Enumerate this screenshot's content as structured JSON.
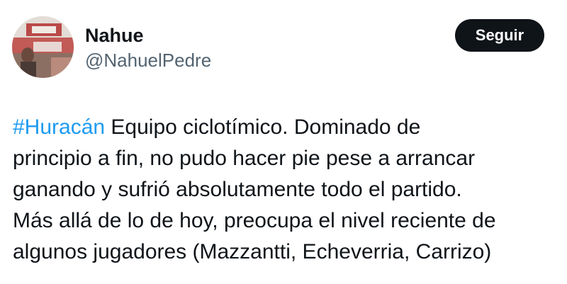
{
  "user": {
    "display_name": "Nahue",
    "handle": "@NahuelPedre"
  },
  "actions": {
    "follow_label": "Seguir"
  },
  "tweet": {
    "hashtag": "#Huracán",
    "line1_rest": " Equipo ciclotímico. Dominado de",
    "line2": "principio a fin, no pudo hacer pie pese a arrancar",
    "line3": "ganando y sufrió absolutamente todo el partido.",
    "line4": "Más allá de lo de hoy, preocupa el nivel reciente de",
    "line5": "algunos jugadores (Mazzantti, Echeverria, Carrizo)"
  },
  "colors": {
    "link": "#1d9bf0",
    "text": "#0f1419",
    "secondary": "#536471",
    "button_bg": "#0f1419"
  },
  "icons": {
    "avatar": "profile-photo"
  }
}
